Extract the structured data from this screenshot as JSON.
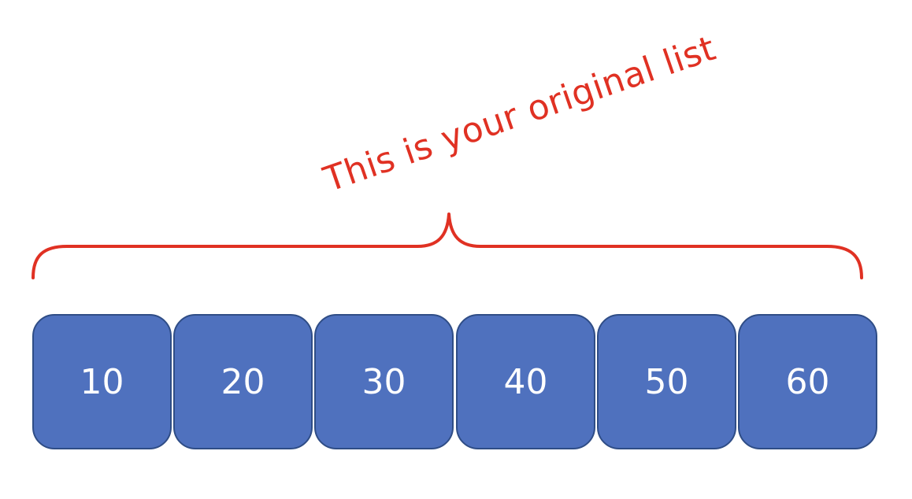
{
  "diagram": {
    "caption": "This is your original list",
    "caption_color": "#e03123",
    "brace_color": "#e03123",
    "cell_fill": "#4f71be",
    "cell_border": "#2f4d86",
    "cell_text_color": "#ffffff",
    "items": [
      "10",
      "20",
      "30",
      "40",
      "50",
      "60"
    ]
  }
}
